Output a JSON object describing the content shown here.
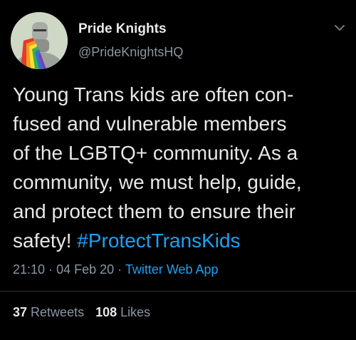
{
  "author": {
    "name": "Pride Knights",
    "handle": "@PrideKnightsHQ"
  },
  "tweet": {
    "lines": [
      "Young Trans kids are often con-",
      "fused and vulnerable members",
      "of the LGBTQ+ community. As a",
      "community, we must help, guide,",
      "and protect them to ensure their",
      "safety! "
    ],
    "hashtag": "#ProtectTransKids"
  },
  "meta": {
    "time": "21:10",
    "separator": "·",
    "date": "04 Feb 20",
    "app": "Twitter Web App"
  },
  "stats": {
    "retweets_count": "37",
    "retweets_label": "Retweets",
    "likes_count": "108",
    "likes_label": "Likes"
  },
  "icons": {
    "menu": "chevron-down-icon"
  },
  "colors": {
    "background": "#000000",
    "link": "#1da1f2",
    "secondary_text": "#8a96a2",
    "primary_text": "#e7e7e7"
  }
}
